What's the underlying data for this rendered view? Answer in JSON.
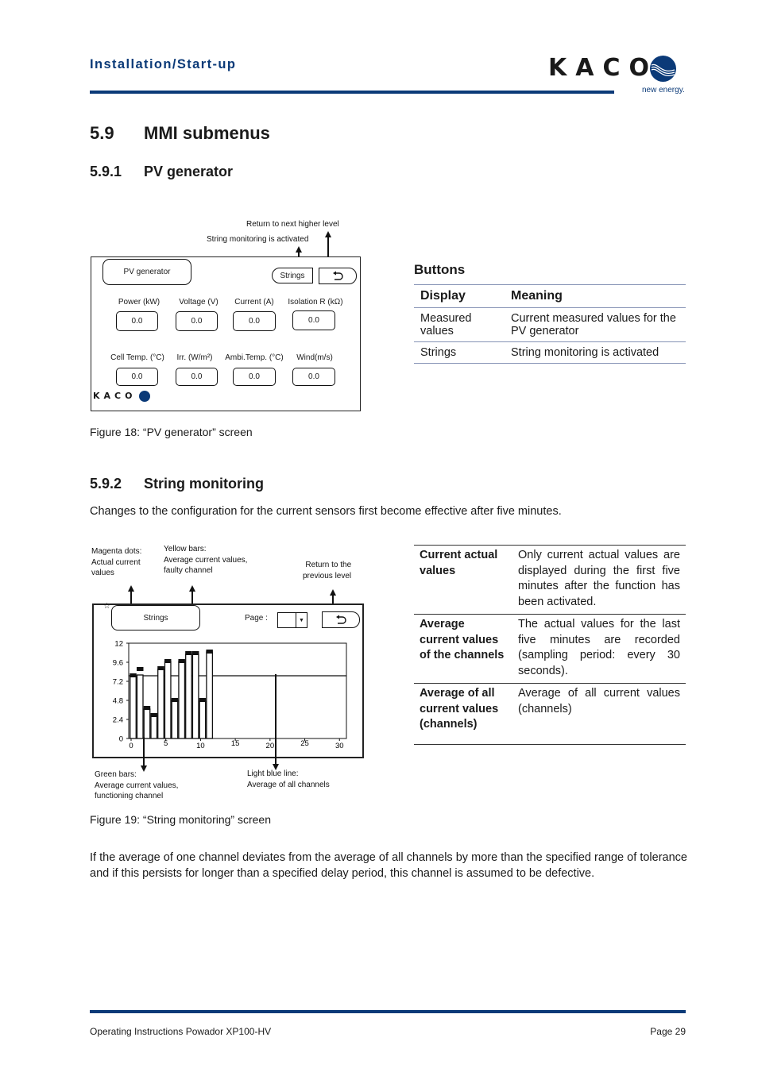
{
  "header": {
    "section_title": "Installation/Start-up",
    "logo_text": "KACO",
    "logo_tagline": "new energy."
  },
  "section": {
    "number": "5.9",
    "title": "MMI submenus"
  },
  "pv": {
    "number": "5.9.1",
    "title": "PV generator",
    "annotations": {
      "return": "Return to next higher level",
      "strings": "String monitoring is activated"
    },
    "screen": {
      "title_button": "PV generator",
      "strings_button": "Strings",
      "back_icon": "return-arrow-icon",
      "fields": [
        {
          "label": "Power (kW)",
          "value": "0.0"
        },
        {
          "label": "Voltage (V)",
          "value": "0.0"
        },
        {
          "label": "Current (A)",
          "value": "0.0"
        },
        {
          "label": "Isolation R (kΩ)",
          "value": "0.0"
        },
        {
          "label": "Cell Temp. (°C)",
          "value": "0.0"
        },
        {
          "label": "Irr. (W/m²)",
          "value": "0.0"
        },
        {
          "label": "Ambi.Temp. (°C)",
          "value": "0.0"
        },
        {
          "label": "Wind(m/s)",
          "value": "0.0"
        }
      ],
      "logo_text": "KACO"
    },
    "caption": "Figure 18:  “PV generator” screen",
    "buttons_table": {
      "title": "Buttons",
      "headers": [
        "Display",
        "Meaning"
      ],
      "rows": [
        [
          "Measured values",
          "Current measured values for the PV generator"
        ],
        [
          "Strings",
          "String monitoring is activated"
        ]
      ]
    }
  },
  "strings": {
    "number": "5.9.2",
    "title": "String monitoring",
    "intro": "Changes to the configuration for the current sensors first become effective after five minutes.",
    "annotations": {
      "magenta": [
        "Magenta dots:",
        "Actual current",
        "values"
      ],
      "yellow": [
        "Yellow bars:",
        "Average current values,",
        "faulty channel"
      ],
      "return": [
        "Return to the",
        "previous level"
      ],
      "green": [
        "Green bars:",
        "Average current values,",
        "functioning channel"
      ],
      "blue": [
        "Light blue line:",
        "Average of all channels"
      ]
    },
    "screen": {
      "title_button": "Strings",
      "page_label": "Page :",
      "page_value": "",
      "back_icon": "return-arrow-icon"
    },
    "caption": "Figure 19:  “String monitoring” screen",
    "legend_table": [
      {
        "key": "Current actual values",
        "value": "Only current actual values are displayed during the first five minutes after the function has been activated."
      },
      {
        "key": "Average current values of the channels",
        "value": "The actual values for the last five minutes are recorded (sampling period: every 30 seconds)."
      },
      {
        "key": "Average of all current values (channels)",
        "value": "Average of all current values (channels)"
      }
    ],
    "conclusion": "If the average of one channel deviates from the average of all channels by more than the specified range of tolerance and if this persists for longer than a specified delay period, this channel is assumed to be defective."
  },
  "chart_data": {
    "type": "bar",
    "title": "",
    "xlabel": "",
    "ylabel": "",
    "x": [
      0,
      1,
      2,
      3,
      4,
      5,
      6,
      7,
      8,
      9,
      10,
      11
    ],
    "series": [
      {
        "name": "Average current values",
        "values": [
          7.9,
          8.0,
          3.7,
          2.9,
          8.7,
          9.7,
          4.8,
          9.7,
          10.6,
          10.6,
          4.7,
          10.9
        ]
      },
      {
        "name": "Actual current values",
        "values": [
          8.1,
          8.9,
          4.0,
          3.1,
          9.0,
          9.9,
          5.0,
          9.9,
          10.9,
          10.9,
          5.0,
          11.1
        ]
      }
    ],
    "average_line": 7.9,
    "xlim": [
      0,
      31
    ],
    "ylim": [
      0,
      12
    ],
    "xticks": [
      "0",
      "5",
      "10",
      "15",
      "20",
      "25",
      "30"
    ],
    "yticks": [
      "0",
      "2.4",
      "4.8",
      "7.2",
      "9.6",
      "12"
    ],
    "grid": false
  },
  "footer": {
    "left": "Operating Instructions Powador XP100-HV",
    "right": "Page 29"
  }
}
